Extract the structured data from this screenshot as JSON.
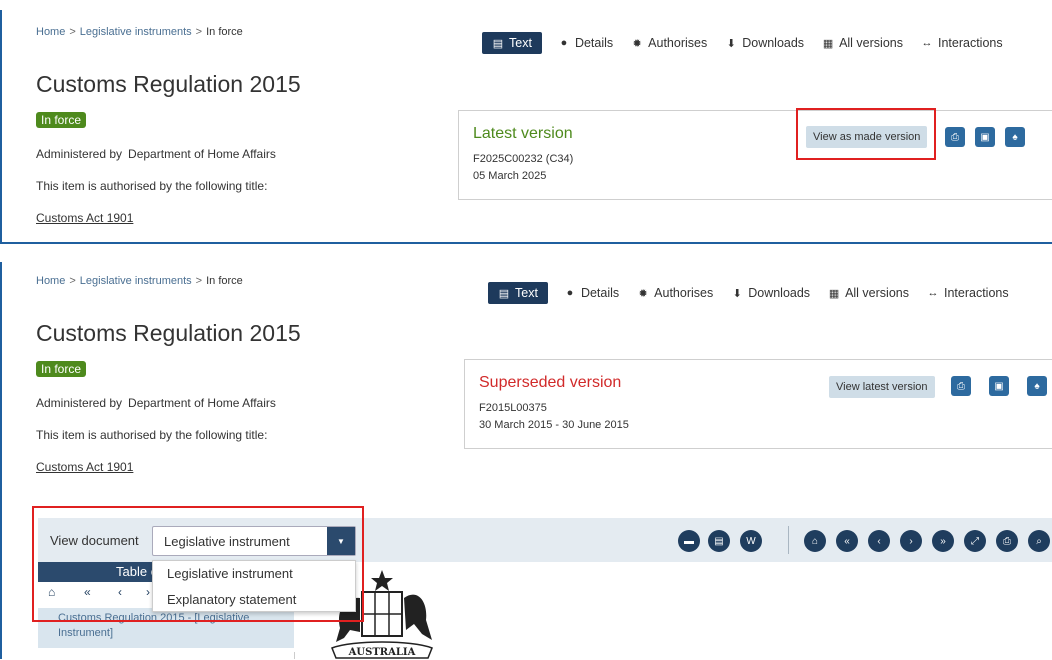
{
  "panel1": {
    "breadcrumb": {
      "home": "Home",
      "sep1": ">",
      "section": "Legislative instruments",
      "sep2": ">",
      "current": "In force"
    },
    "title": "Customs Regulation 2015",
    "status_badge": "In force",
    "admin_label": "Administered by",
    "admin_dept": "Department of Home Affairs",
    "authorised_text": "This item is authorised by the following title:",
    "act_link": "Customs Act 1901",
    "tabs": [
      "Text",
      "Details",
      "Authorises",
      "Downloads",
      "All versions",
      "Interactions"
    ],
    "version": {
      "title": "Latest version",
      "title_color": "#4e8a1d",
      "id": "F2025C00232 (C34)",
      "date": "05 March 2025",
      "button": "View as made version"
    }
  },
  "panel2": {
    "breadcrumb": {
      "home": "Home",
      "sep1": ">",
      "section": "Legislative instruments",
      "sep2": ">",
      "current": "In force"
    },
    "title": "Customs Regulation 2015",
    "status_badge": "In force",
    "admin_label": "Administered by",
    "admin_dept": "Department of Home Affairs",
    "authorised_text": "This item is authorised by the following title:",
    "act_link": "Customs Act 1901",
    "tabs": [
      "Text",
      "Details",
      "Authorises",
      "Downloads",
      "All versions",
      "Interactions"
    ],
    "version": {
      "title": "Superseded version",
      "title_color": "#d12a2a",
      "id": "F2015L00375",
      "date": "30 March 2015 - 30 June 2015",
      "button": "View latest version"
    },
    "viewer": {
      "label": "View document",
      "selected": "Legislative instrument",
      "options": [
        "Legislative instrument",
        "Explanatory statement"
      ],
      "toc_title": "Table of contents",
      "toc_item": "Customs Regulation 2015 - [Legislative Instrument]",
      "crest_text": "AUSTRALIA"
    }
  },
  "icons": {
    "tabs": [
      "file-icon",
      "info-icon",
      "seal-icon",
      "download-icon",
      "calendar-icon",
      "arrows-icon"
    ],
    "toolbar": [
      "print-icon",
      "save-icon",
      "bell-icon"
    ],
    "doc_buttons": [
      "document-icon",
      "file-icon",
      "word-file-icon"
    ],
    "nav_buttons": [
      "home-icon",
      "double-left-icon",
      "left-icon",
      "right-icon",
      "double-right-icon",
      "expand-icon",
      "print-icon",
      "search-icon"
    ]
  },
  "colors": {
    "accent_dark": "#1e3a5c",
    "badge_green": "#4e8a1d",
    "highlight_red": "#e02020",
    "panel_border": "#1f5f9f"
  }
}
